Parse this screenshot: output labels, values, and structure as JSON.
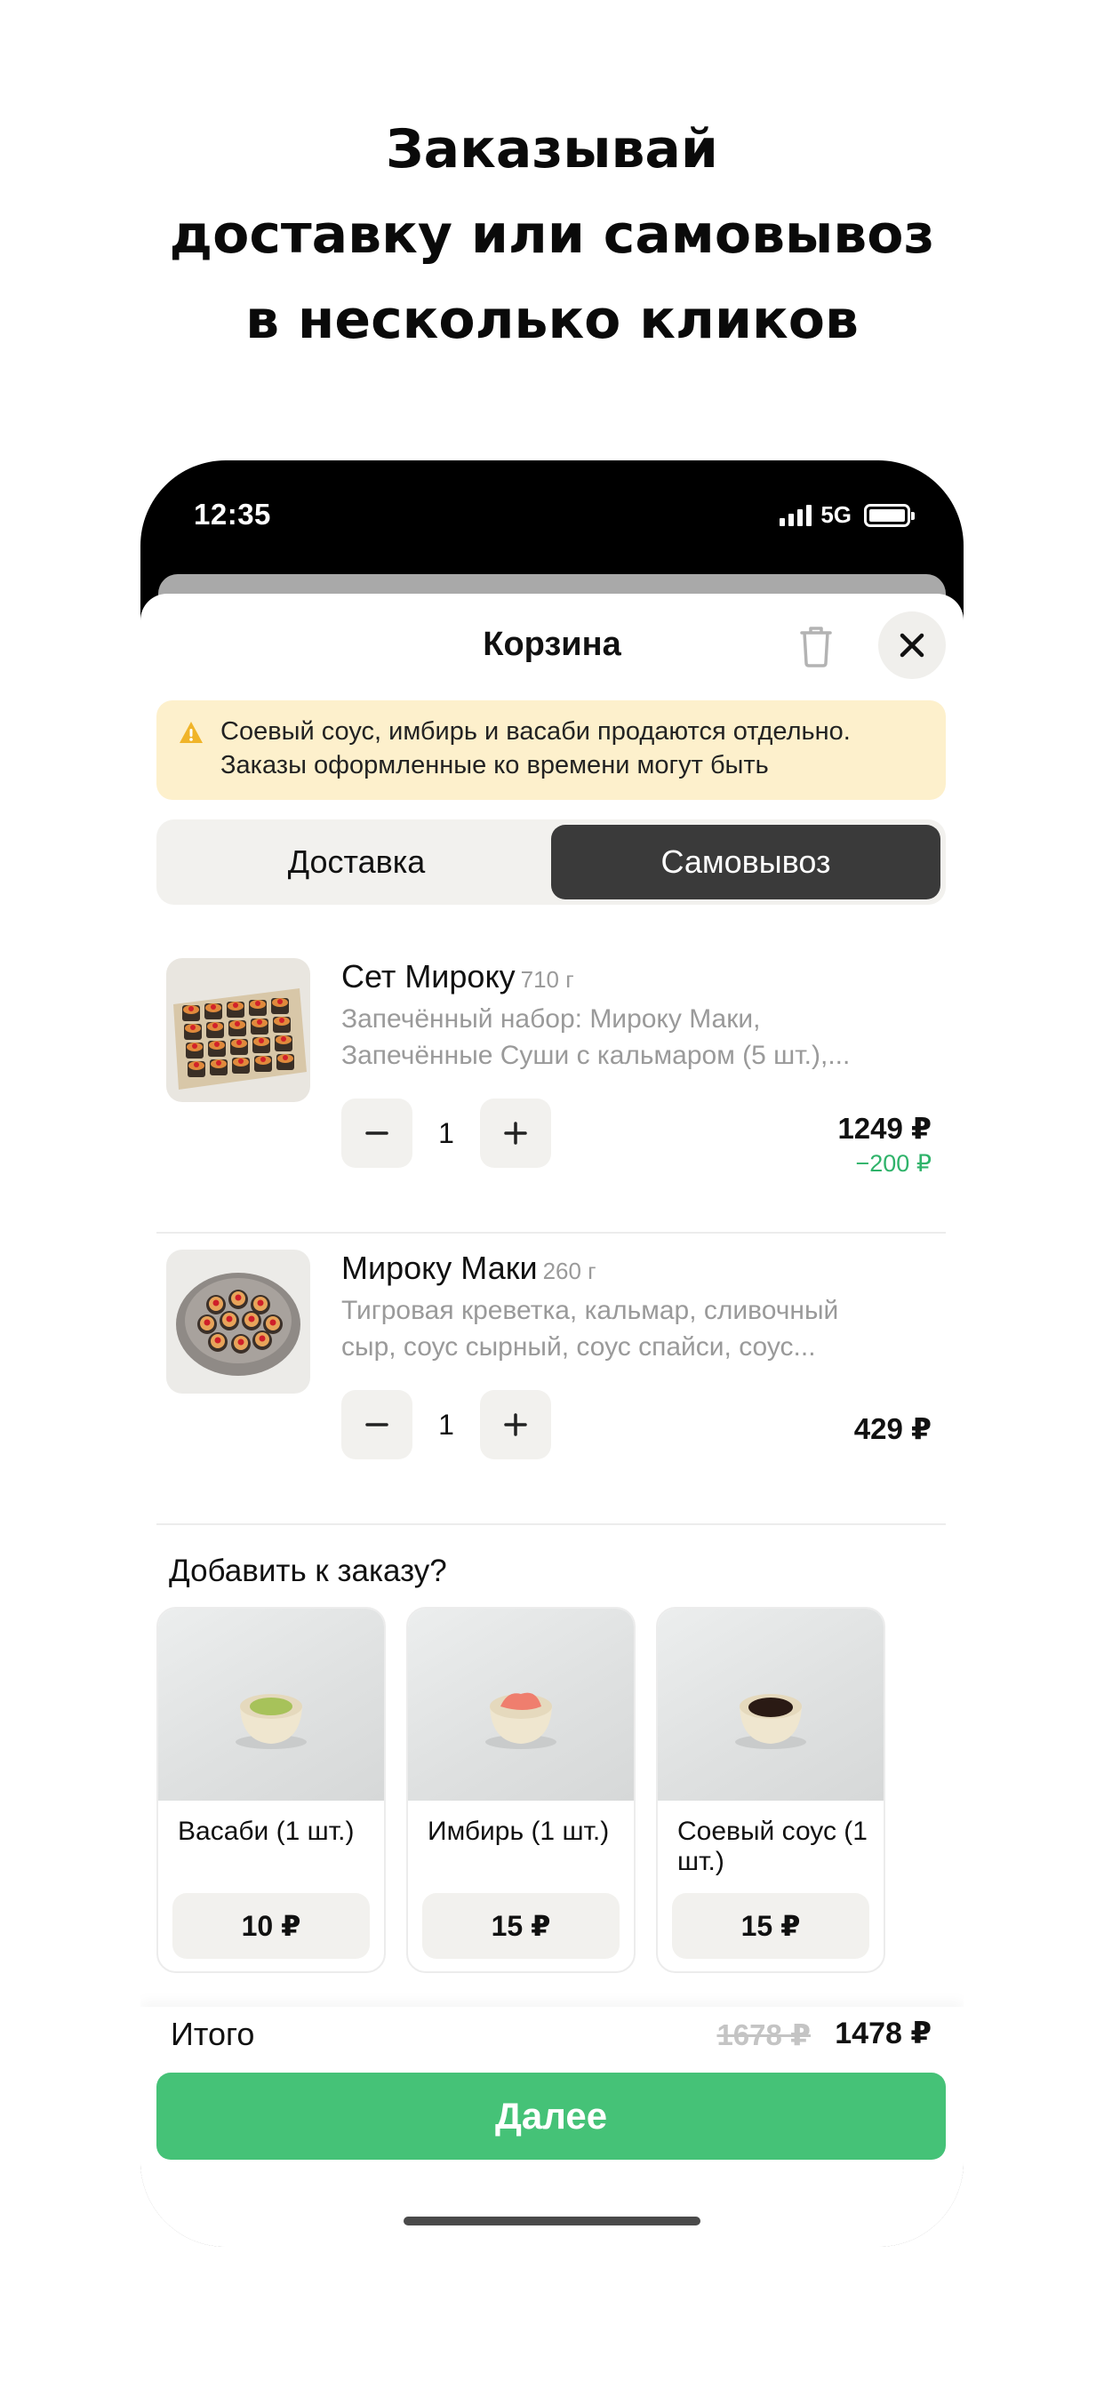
{
  "headline": {
    "line1": "Заказывай",
    "line2": "доставку или самовывоз",
    "line3": "в несколько кликов"
  },
  "status_bar": {
    "time": "12:35",
    "network": "5G",
    "icons": [
      "signal-icon",
      "battery-icon"
    ]
  },
  "cart": {
    "title": "Корзина",
    "trash_icon": "trash-icon",
    "close_icon": "close-icon",
    "notice": {
      "line1": "Соевый соус, имбирь и васаби продаются отдельно.",
      "line2": "Заказы оформленные ко времени могут быть",
      "icon": "warning-icon"
    },
    "modes": {
      "delivery": "Доставка",
      "pickup": "Самовывоз",
      "selected": "pickup"
    },
    "items": [
      {
        "name": "Сет Мироку",
        "weight": "710 г",
        "desc_line1": "Запечённый набор: Мироку Маки,",
        "desc_line2": "Запечённые Суши с кальмаром (5 шт.),...",
        "qty": "1",
        "price": "1249 ₽",
        "discount": "−200 ₽"
      },
      {
        "name": "Мироку Маки",
        "weight": "260 г",
        "desc_line1": "Тигровая креветка, кальмар, сливочный",
        "desc_line2": "сыр, соус сырный, соус спайси, соус...",
        "qty": "1",
        "price": "429 ₽"
      }
    ],
    "addons": {
      "title": "Добавить к заказу?",
      "items": [
        {
          "name": "Васаби (1 шт.)",
          "price": "10 ₽"
        },
        {
          "name": "Имбирь (1 шт.)",
          "price": "15 ₽"
        },
        {
          "name": "Соевый соус (1 шт.)",
          "price": "15 ₽"
        }
      ]
    },
    "footer": {
      "total_label": "Итого",
      "total_old": "1678 ₽",
      "total_new": "1478 ₽",
      "next_label": "Далее"
    }
  },
  "colors": {
    "accent_green": "#45c277",
    "discount_green": "#2fb36a",
    "notice_bg": "#fdf0cc",
    "selected_segment": "#3a3a3a"
  }
}
